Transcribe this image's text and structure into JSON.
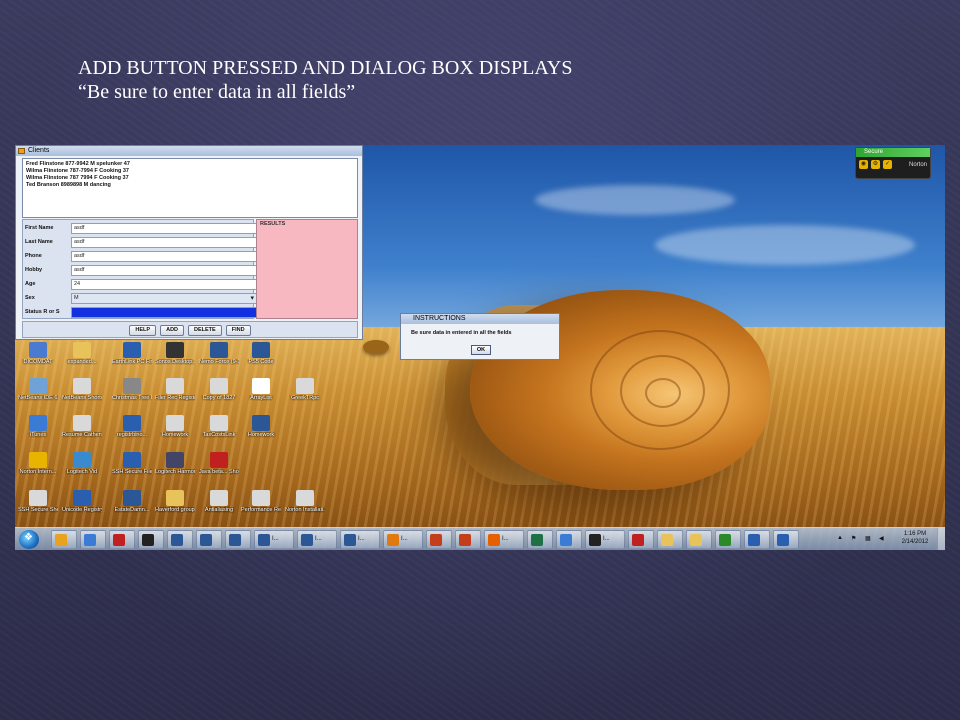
{
  "slide": {
    "title_line1": "ADD BUTTON PRESSED AND DIALOG BOX DISPLAYS",
    "title_line2": "“Be sure to enter data in all fields”"
  },
  "clients_window": {
    "title": "Clients",
    "list_items": [
      "Fred Flinstone 877-9942 M spelunker 47",
      "Wilma Flinstone 787-7994 F Cooking 37",
      "Wilma Flinstone 787 7994 F Cooking 37",
      "Ted Branson 8989898 M dancing"
    ],
    "fields": [
      {
        "label": "First Name",
        "value": "asdf"
      },
      {
        "label": "Last Name",
        "value": "asdf"
      },
      {
        "label": "Phone",
        "value": "asdf"
      },
      {
        "label": "Hobby",
        "value": "asdf"
      },
      {
        "label": "Age",
        "value": "24"
      },
      {
        "label": "Sex",
        "value": "M"
      },
      {
        "label": "Status R or S",
        "value": ""
      }
    ],
    "results_label": "RESULTS",
    "buttons": [
      "HELP",
      "ADD",
      "DELETE",
      "FIND"
    ]
  },
  "dialog": {
    "title": "INSTRUCTIONS",
    "message": "Be sure data in entered in all the fields",
    "ok_label": "OK"
  },
  "norton": {
    "status": "Secure",
    "brand": "Norton"
  },
  "desktop_icons": [
    {
      "label": "DICOMDAT",
      "color": "#4a7bd0",
      "icon": "folder-icon"
    },
    {
      "label": "expanded...",
      "color": "#e8c25a",
      "icon": "folder-icon"
    },
    {
      "label": "EarthLink PC FineTune",
      "color": "#2a5fb0",
      "icon": "app-icon"
    },
    {
      "label": "Sonos Desktop...",
      "color": "#333333",
      "icon": "app-icon"
    },
    {
      "label": "Nemo Force (9-1-11)",
      "color": "#2b5797",
      "icon": "word-doc-icon"
    },
    {
      "label": "PS5 Code",
      "color": "#2b5797",
      "icon": "word-doc-icon"
    },
    {
      "label": "NetBeans IDE 6.8",
      "color": "#6fa3d8",
      "icon": "netbeans-icon"
    },
    {
      "label": "NetBeans Shortcuts",
      "color": "#d9d9d9",
      "icon": "doc-icon"
    },
    {
      "label": "Christmas Tree Image",
      "color": "#888888",
      "icon": "image-icon"
    },
    {
      "label": "Filer Rec Registen",
      "color": "#d9d9d9",
      "icon": "doc-icon"
    },
    {
      "label": "Copy of 1827",
      "color": "#d9d9d9",
      "icon": "doc-icon"
    },
    {
      "label": "ArrayList",
      "color": "#ffffff",
      "icon": "g-icon"
    },
    {
      "label": "GreekTRpc",
      "color": "#d9d9d9",
      "icon": "pdf-icon"
    },
    {
      "label": "iTunes",
      "color": "#3a7bd5",
      "icon": "itunes-icon"
    },
    {
      "label": "Resume Cathen...",
      "color": "#d9d9d9",
      "icon": "doc-icon"
    },
    {
      "label": "registrbino...",
      "color": "#2a5fb0",
      "icon": "app-icon"
    },
    {
      "label": "Homework",
      "color": "#d9d9d9",
      "icon": "doc-icon"
    },
    {
      "label": "TaxCostsLink",
      "color": "#d9d9d9",
      "icon": "doc-icon"
    },
    {
      "label": "Homework",
      "color": "#2b5797",
      "icon": "word-doc-icon"
    },
    {
      "label": "Norton Intern...",
      "color": "#e8b400",
      "icon": "norton-icon"
    },
    {
      "label": "Logitech Vid",
      "color": "#3a8ad0",
      "icon": "app-icon"
    },
    {
      "label": "SSH Secure File Transfe...",
      "color": "#2a5fb0",
      "icon": "app-icon"
    },
    {
      "label": "Logitech Harmony",
      "color": "#444466",
      "icon": "app-icon"
    },
    {
      "label": "Java beta... Shortcuts",
      "color": "#c02020",
      "icon": "java-icon"
    },
    {
      "label": "SSH Secure Shell Client",
      "color": "#d9d9d9",
      "icon": "app-icon"
    },
    {
      "label": "Unicode Registry Bo",
      "color": "#2a5fb0",
      "icon": "app-icon"
    },
    {
      "label": "EstateDamn...",
      "color": "#2b5797",
      "icon": "word-doc-icon"
    },
    {
      "label": "Haverford group email",
      "color": "#e8c25a",
      "icon": "mail-icon"
    },
    {
      "label": "Antialiasing",
      "color": "#d9d9d9",
      "icon": "doc-icon"
    },
    {
      "label": "Performance Reviews 2009",
      "color": "#d9d9d9",
      "icon": "doc-icon"
    },
    {
      "label": "Norton Installati...",
      "color": "#d9d9d9",
      "icon": "doc-icon"
    }
  ],
  "taskbar": {
    "items": [
      {
        "label": "",
        "color": "#e8a21e",
        "icon": "media-player-icon"
      },
      {
        "label": "",
        "color": "#3a7bd5",
        "icon": "chrome-icon"
      },
      {
        "label": "",
        "color": "#c02020",
        "icon": "app-icon"
      },
      {
        "label": "",
        "color": "#222222",
        "icon": "g-icon"
      },
      {
        "label": "",
        "color": "#2b5797",
        "icon": "word-icon"
      },
      {
        "label": "",
        "color": "#2b5797",
        "icon": "word-icon"
      },
      {
        "label": "",
        "color": "#2b5797",
        "icon": "word-icon"
      },
      {
        "label": "I...",
        "color": "#2b5797",
        "icon": "word-icon"
      },
      {
        "label": "I...",
        "color": "#2b5797",
        "icon": "word-icon"
      },
      {
        "label": "I...",
        "color": "#2b5797",
        "icon": "word-icon"
      },
      {
        "label": "I...",
        "color": "#e07a10",
        "icon": "outlook-icon"
      },
      {
        "label": "",
        "color": "#c43e1c",
        "icon": "powerpoint-icon"
      },
      {
        "label": "",
        "color": "#c43e1c",
        "icon": "powerpoint-icon"
      },
      {
        "label": "I...",
        "color": "#e66000",
        "icon": "firefox-icon"
      },
      {
        "label": "",
        "color": "#1e7145",
        "icon": "excel-icon"
      },
      {
        "label": "",
        "color": "#3a7bd5",
        "icon": "chrome-icon"
      },
      {
        "label": "I...",
        "color": "#222222",
        "icon": "g-icon"
      },
      {
        "label": "",
        "color": "#c02020",
        "icon": "app-icon"
      },
      {
        "label": "",
        "color": "#e8c25a",
        "icon": "folder-icon"
      },
      {
        "label": "",
        "color": "#e8c25a",
        "icon": "folder-icon"
      },
      {
        "label": "",
        "color": "#2a8a2a",
        "icon": "app-icon"
      },
      {
        "label": "",
        "color": "#2a5fb0",
        "icon": "app-icon"
      },
      {
        "label": "",
        "color": "#2a5fb0",
        "icon": "app-icon"
      }
    ],
    "clock_time": "1:16 PM",
    "clock_date": "2/14/2012"
  }
}
